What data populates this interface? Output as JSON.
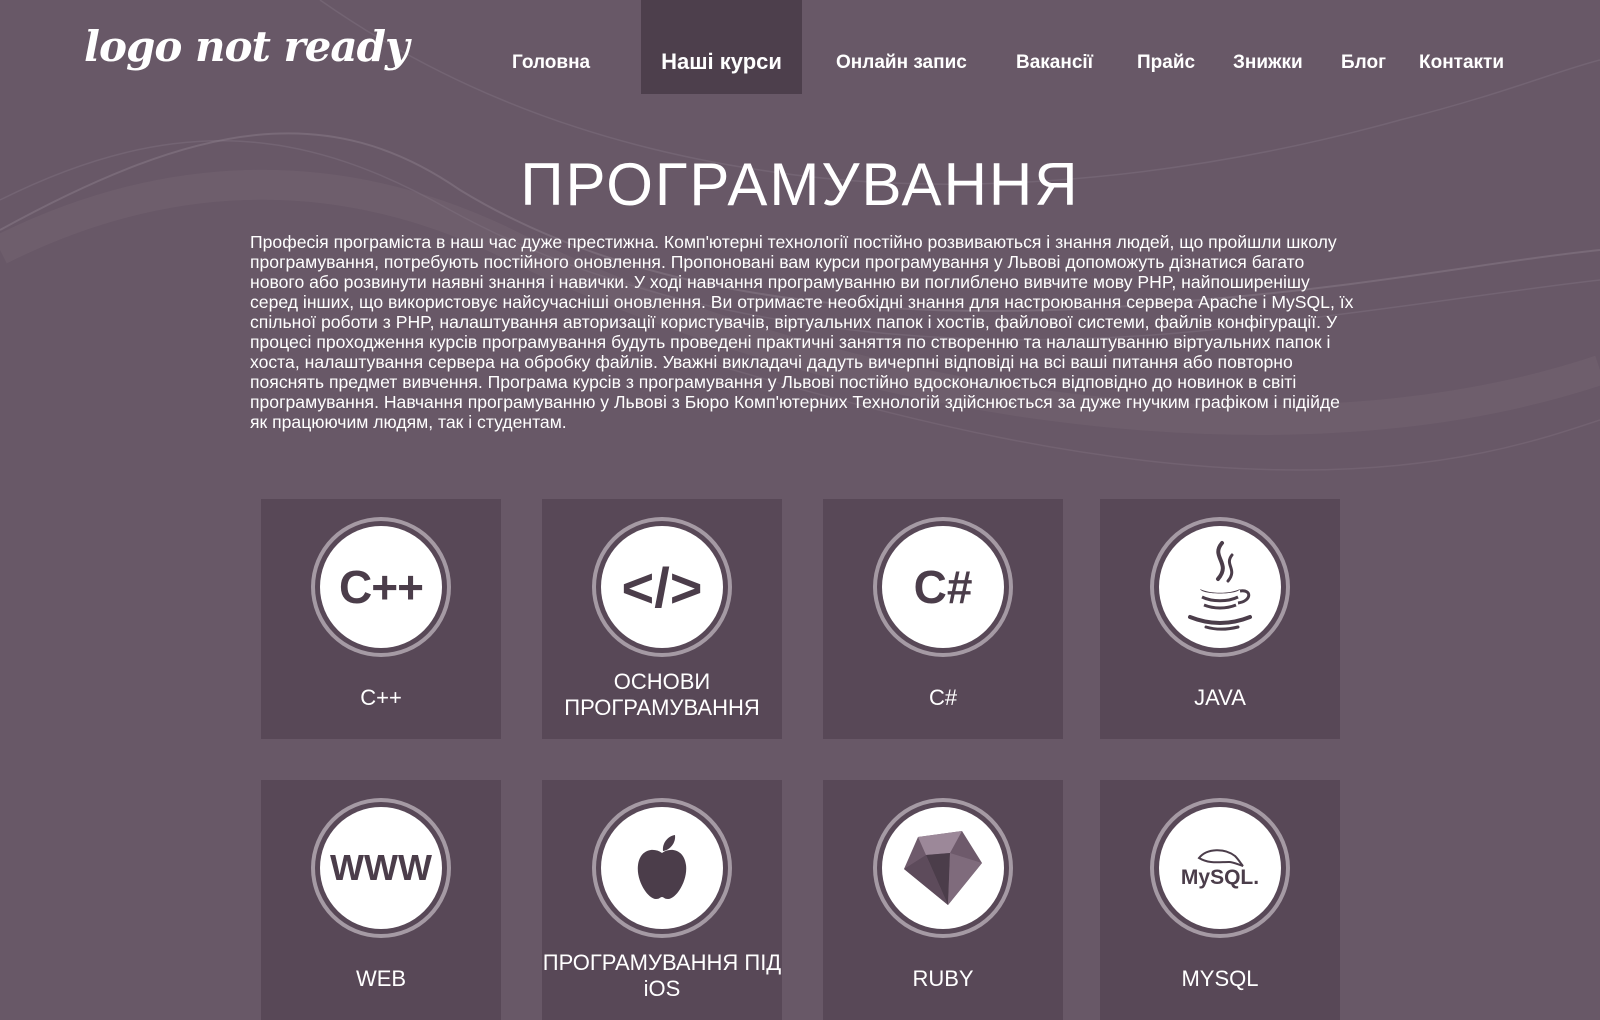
{
  "logo": {
    "text": "logo not ready"
  },
  "nav": {
    "items": [
      {
        "label": "Головна"
      },
      {
        "label": "Наші курси",
        "active": true
      },
      {
        "label": "Онлайн запис"
      },
      {
        "label": "Вакансії"
      },
      {
        "label": "Прайс"
      },
      {
        "label": "Знижки"
      },
      {
        "label": "Блог"
      },
      {
        "label": "Контакти"
      }
    ]
  },
  "main": {
    "title": "ПРОГРАМУВАННЯ",
    "intro": "Професія програміста в наш час дуже престижна. Комп'ютерні технології постійно розвиваються і знання людей, що пройшли школу програмування, потребують постійного оновлення. Пропоновані вам курси програмування у Львові допоможуть дізнатися багато нового або розвинути наявні знання і навички. У ході навчання програмуванню ви поглиблено вивчите мову PHP, найпоширенішу серед інших, що використовує найсучасніші оновлення. Ви отримаєте необхідні знання для настроювання сервера Apache і MySQL, їх спільної роботи з PHP, налаштування авторизації користувачів, віртуальних папок і хостів, файлової системи, файлів конфігурації. У процесі проходження курсів програмування будуть проведені практичні заняття по створенню та налаштуванню віртуальних папок і хоста, налаштування сервера на обробку файлів. Уважні викладачі дадуть вичерпні відповіді на всі ваші питання або повторно пояснять предмет вивчення. Програма курсів з програмування у Львові постійно вдосконалюється відповідно до новинок в світі програмування. Навчання програмуванню у Львові з Бюро Комп'ютерних Технологій здійснюється за дуже гнучким графіком і підійде як працюючим людям, так і студентам."
  },
  "courses": [
    {
      "label": "C++",
      "icon": "cpp-icon",
      "icon_text": "C++"
    },
    {
      "label": "ОСНОВИ ПРОГРАМУВАННЯ",
      "icon": "code-tag-icon",
      "icon_text": "</>"
    },
    {
      "label": "C#",
      "icon": "csharp-icon",
      "icon_text": "C#"
    },
    {
      "label": "JAVA",
      "icon": "java-cup-icon"
    },
    {
      "label": "WEB",
      "icon": "www-icon",
      "icon_text": "WWW"
    },
    {
      "label": "ПРОГРАМУВАННЯ ПІД iOS",
      "icon": "apple-icon"
    },
    {
      "label": "RUBY",
      "icon": "ruby-gem-icon"
    },
    {
      "label": "MYSQL",
      "icon": "mysql-dolphin-icon",
      "icon_text": "MySQL."
    }
  ],
  "colors": {
    "background": "#685867",
    "active_nav": "#4d3f4c",
    "card": "#584857",
    "ring": "#a59aa4",
    "icon_fill": "#4b3d4a"
  }
}
